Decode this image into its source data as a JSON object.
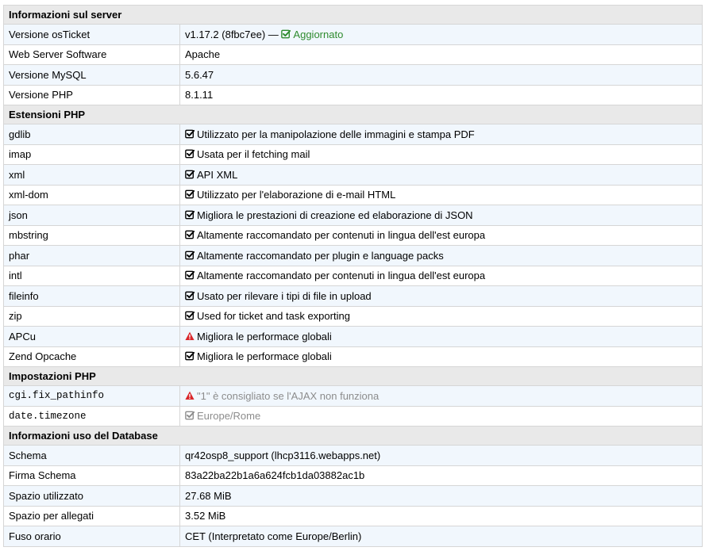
{
  "sections": {
    "server": "Informazioni sul server",
    "extensions": "Estensioni PHP",
    "settings": "Impostazioni PHP",
    "database": "Informazioni uso del Database"
  },
  "server": [
    {
      "label": "Versione osTicket",
      "value": "v1.17.2 (8fbc7ee) —",
      "status": "Aggiornato"
    },
    {
      "label": "Web Server Software",
      "value": "Apache"
    },
    {
      "label": "Versione MySQL",
      "value": "5.6.47"
    },
    {
      "label": "Versione PHP",
      "value": "8.1.11"
    }
  ],
  "extensions": [
    {
      "name": "gdlib",
      "icon": "check-square-icon",
      "desc": "Utilizzato per la manipolazione delle immagini e stampa PDF"
    },
    {
      "name": "imap",
      "icon": "check-square-icon",
      "desc": "Usata per il fetching mail"
    },
    {
      "name": "xml",
      "icon": "check-square-icon",
      "desc": "API XML"
    },
    {
      "name": "xml-dom",
      "icon": "check-square-icon",
      "desc": "Utilizzato per l'elaborazione di e-mail HTML"
    },
    {
      "name": "json",
      "icon": "check-square-icon",
      "desc": "Migliora le prestazioni di creazione ed elaborazione di JSON"
    },
    {
      "name": "mbstring",
      "icon": "check-square-icon",
      "desc": "Altamente raccomandato per contenuti in lingua dell'est europa"
    },
    {
      "name": "phar",
      "icon": "check-square-icon",
      "desc": "Altamente raccomandato per plugin e language packs"
    },
    {
      "name": "intl",
      "icon": "check-square-icon",
      "desc": "Altamente raccomandato per contenuti in lingua dell'est europa"
    },
    {
      "name": "fileinfo",
      "icon": "check-square-icon",
      "desc": "Usato per rilevare i tipi di file in upload"
    },
    {
      "name": "zip",
      "icon": "check-square-icon",
      "desc": "Used for ticket and task exporting"
    },
    {
      "name": "APCu",
      "icon": "warning-icon",
      "desc": "Migliora le performace globali"
    },
    {
      "name": "Zend Opcache",
      "icon": "check-square-icon",
      "desc": "Migliora le performace globali"
    }
  ],
  "settings": [
    {
      "name": "cgi.fix_pathinfo",
      "icon": "warning-icon",
      "desc": "\"1\" è consigliato se l'AJAX non funziona"
    },
    {
      "name": "date.timezone",
      "icon": "check-square-icon",
      "desc": "Europe/Rome"
    }
  ],
  "database": [
    {
      "label": "Schema",
      "value": "qr42osp8_support (lhcp3116.webapps.net)"
    },
    {
      "label": "Firma Schema",
      "value": "83a22ba22b1a6a624fcb1da03882ac1b"
    },
    {
      "label": "Spazio utilizzato",
      "value": "27.68 MiB"
    },
    {
      "label": "Spazio per allegati",
      "value": "3.52 MiB"
    },
    {
      "label": "Fuso orario",
      "value": "CET (Interpretato come Europe/Berlin)"
    }
  ],
  "colors": {
    "ok": "#2e8b2e",
    "warning": "#d9262a",
    "section_bg": "#e9e9e9",
    "alt_row_bg": "#f1f7fd",
    "muted": "#8c8c8c"
  }
}
